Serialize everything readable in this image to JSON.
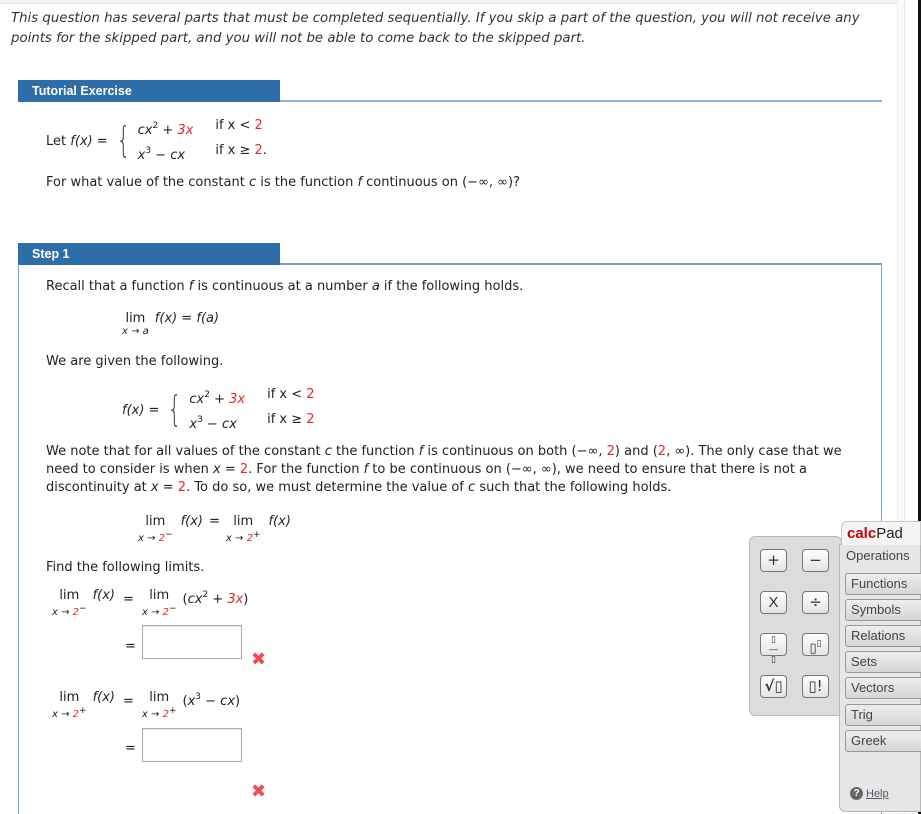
{
  "instructions": "This question has several parts that must be completed sequentially. If you skip a part of the question, you will not receive any points for the skipped part, and you will not be able to come back to the skipped part.",
  "tutorial": {
    "header": "Tutorial Exercise",
    "let_label": "Let",
    "func": "f(x)",
    "case1_expr": [
      "cx",
      "2",
      " + ",
      "3x"
    ],
    "case1_cond": [
      "if  x < ",
      "2"
    ],
    "case2_expr": [
      "x",
      "3",
      " − cx"
    ],
    "case2_cond": [
      "if  x ≥ ",
      "2",
      "."
    ],
    "question": [
      "For what value of the constant ",
      "c",
      " is the function ",
      "f",
      " continuous on (−∞, ∞)?"
    ]
  },
  "step1": {
    "header": "Step 1",
    "recall": [
      "Recall that a function ",
      "f",
      " is continuous at a number ",
      "a",
      " if the following holds."
    ],
    "limit_def": {
      "lim": "lim",
      "sub": "x → a",
      "rhs": "f(x) = f(a)"
    },
    "given": "We are given the following.",
    "note_lines": [
      [
        "We note that for all values of the constant ",
        "c",
        " the function ",
        "f",
        " is continuous on both (−∞, ",
        "2",
        ") and (",
        "2",
        ", ∞). The only case that we"
      ],
      [
        "need to consider is when ",
        "x",
        " = ",
        "2",
        ". For the function ",
        "f",
        " to be continuous on (−∞, ∞), we need to ensure that there is not a"
      ],
      [
        "discontinuity at ",
        "x",
        " = ",
        "2",
        ". To do so, we must determine the value of ",
        "c",
        " such that the following holds."
      ]
    ],
    "find": "Find the following limits.",
    "left_limit": {
      "expr": "(cx² + 3x)",
      "answer": ""
    },
    "right_limit": {
      "expr": "(x³ − cx)",
      "answer": ""
    },
    "lim": "lim",
    "x_to": "x → ",
    "two": "2",
    "minus": "−",
    "plus": "+",
    "fx": "f(x)",
    "eq": "=",
    "wrong_icon": "✖"
  },
  "calcpad": {
    "title_bold": "calc",
    "title_rest": "Pad",
    "keys": [
      "+",
      "−",
      "X",
      "÷",
      "▯/▯",
      "▯▯",
      "√▯",
      "▯!"
    ],
    "tabs": [
      "Operations",
      "Functions",
      "Symbols",
      "Relations",
      "Sets",
      "Vectors",
      "Trig",
      "Greek"
    ],
    "help": "Help"
  }
}
